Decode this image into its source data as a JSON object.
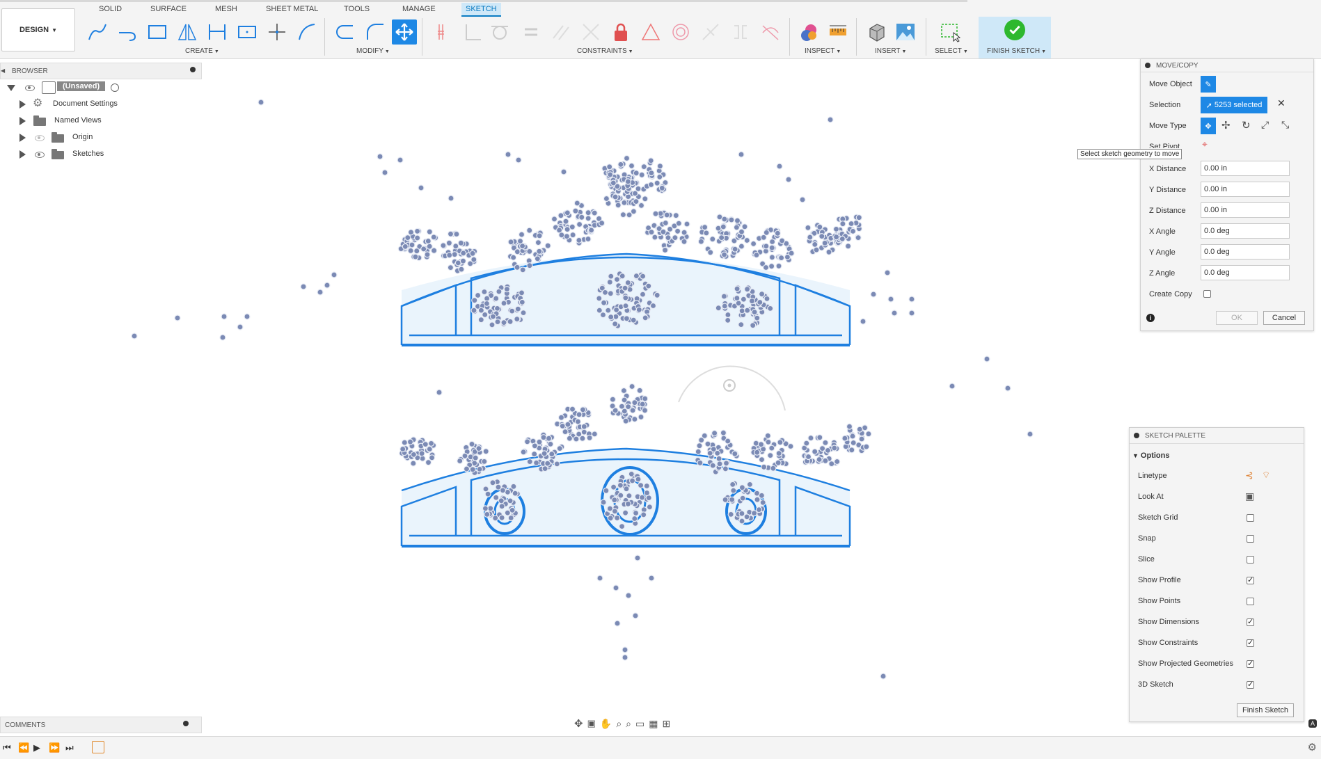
{
  "toolbar": {
    "design_label": "DESIGN",
    "tabs": [
      "SOLID",
      "SURFACE",
      "MESH",
      "SHEET METAL",
      "TOOLS",
      "MANAGE",
      "SKETCH"
    ],
    "groups": {
      "create": "CREATE",
      "modify": "MODIFY",
      "constraints": "CONSTRAINTS",
      "inspect": "INSPECT",
      "insert": "INSERT",
      "select": "SELECT",
      "finish": "FINISH SKETCH"
    }
  },
  "browser": {
    "title": "BROWSER",
    "root": "(Unsaved)",
    "items": [
      "Document Settings",
      "Named Views",
      "Origin",
      "Sketches"
    ]
  },
  "comments": {
    "title": "COMMENTS"
  },
  "move_copy": {
    "title": "MOVE/COPY",
    "move_object_label": "Move Object",
    "selection_label": "Selection",
    "selection_value": "5253 selected",
    "move_type_label": "Move Type",
    "set_pivot_label": "Set Pivot",
    "tooltip": "Select sketch geometry to move",
    "fields": [
      {
        "label": "X Distance",
        "value": "0.00 in"
      },
      {
        "label": "Y Distance",
        "value": "0.00 in"
      },
      {
        "label": "Z Distance",
        "value": "0.00 in"
      },
      {
        "label": "X Angle",
        "value": "0.0 deg"
      },
      {
        "label": "Y Angle",
        "value": "0.0 deg"
      },
      {
        "label": "Z Angle",
        "value": "0.0 deg"
      }
    ],
    "create_copy_label": "Create Copy",
    "ok_label": "OK",
    "cancel_label": "Cancel"
  },
  "palette": {
    "title": "SKETCH PALETTE",
    "options_label": "Options",
    "linetype_label": "Linetype",
    "look_at_label": "Look At",
    "options": [
      {
        "label": "Sketch Grid",
        "checked": false
      },
      {
        "label": "Snap",
        "checked": false
      },
      {
        "label": "Slice",
        "checked": false
      },
      {
        "label": "Show Profile",
        "checked": true
      },
      {
        "label": "Show Points",
        "checked": false
      },
      {
        "label": "Show Dimensions",
        "checked": true
      },
      {
        "label": "Show Constraints",
        "checked": true
      },
      {
        "label": "Show Projected Geometries",
        "checked": true
      },
      {
        "label": "3D Sketch",
        "checked": true
      }
    ],
    "finish_label": "Finish Sketch"
  },
  "colors": {
    "accent": "#1e88e5",
    "sketch_line": "#1e7fe0",
    "profile_fill": "#eaf4fc",
    "point_fill": "#7b8ab4",
    "finish_green": "#2eb82e"
  }
}
